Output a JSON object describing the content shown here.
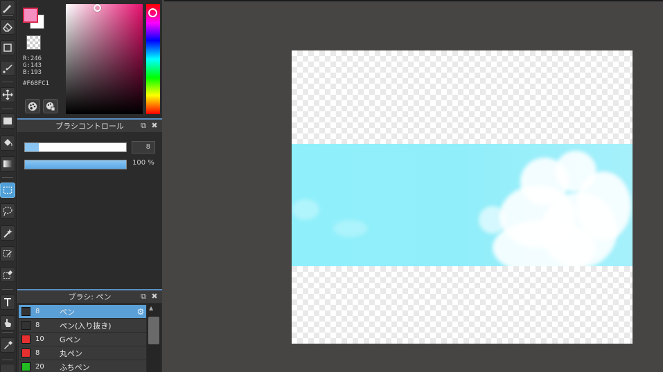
{
  "toolbar": {
    "tools": [
      {
        "name": "brush-tool",
        "icon": "brush-icon"
      },
      {
        "name": "eraser-tool",
        "icon": "eraser-icon"
      },
      {
        "name": "shape-tool",
        "icon": "square-icon"
      },
      {
        "name": "dot-line-tool",
        "icon": "dotline-icon"
      },
      {
        "name": "move-tool",
        "icon": "move-icon"
      },
      {
        "name": "fill-rect-tool",
        "icon": "rect-fill-icon"
      },
      {
        "name": "bucket-tool",
        "icon": "bucket-icon"
      },
      {
        "name": "gradient-tool",
        "icon": "gradient-icon"
      },
      {
        "name": "select-rect-tool",
        "icon": "select-rect-icon",
        "active": true
      },
      {
        "name": "lasso-tool",
        "icon": "lasso-icon"
      },
      {
        "name": "magic-wand-tool",
        "icon": "wand-icon"
      },
      {
        "name": "select-pen-tool",
        "icon": "select-pen-icon"
      },
      {
        "name": "select-eraser-tool",
        "icon": "select-eraser-icon"
      },
      {
        "name": "text-tool",
        "icon": "text-icon"
      },
      {
        "name": "operation-tool",
        "icon": "hand-icon"
      },
      {
        "name": "eyedropper-tool",
        "icon": "eyedropper-icon"
      }
    ],
    "text_tool_glyph": "T"
  },
  "color": {
    "foreground": "#F68FC1",
    "background": "#FFFFFF",
    "r": "R:246",
    "g": "G:143",
    "b": "B:193",
    "hex": "#F68FC1",
    "hue_color": "#e8106e"
  },
  "brush_control": {
    "title": "ブラシコントロール",
    "size_value": "8",
    "size_fraction": 0.14,
    "opacity_value": "100 %",
    "opacity_fraction": 1.0
  },
  "brush_list": {
    "title": "ブラシ: ペン",
    "items": [
      {
        "size": "8",
        "name": "ペン",
        "color": "#333333",
        "selected": true
      },
      {
        "size": "8",
        "name": "ペン(入り抜き)",
        "color": "#333333",
        "selected": false
      },
      {
        "size": "10",
        "name": "Gペン",
        "color": "#e83030",
        "selected": false
      },
      {
        "size": "8",
        "name": "丸ペン",
        "color": "#e83030",
        "selected": false
      },
      {
        "size": "20",
        "name": "ふちペン",
        "color": "#22bb22",
        "selected": false
      }
    ]
  },
  "icons": {
    "popout": "popout-icon",
    "close": "close-icon",
    "gear": "gear-icon"
  }
}
